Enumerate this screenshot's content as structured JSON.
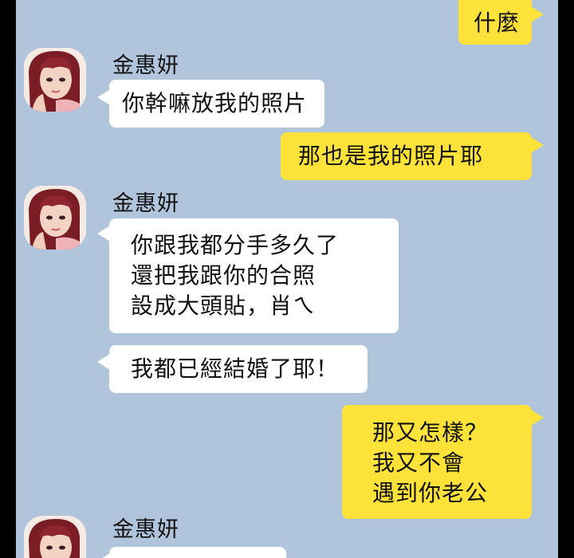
{
  "chat": {
    "contact_name": "金惠妍",
    "messages": [
      {
        "from": "me",
        "text": "什麼"
      },
      {
        "from": "contact",
        "sender": "金惠妍",
        "text": "你幹嘛放我的照片"
      },
      {
        "from": "me",
        "text": "那也是我的照片耶"
      },
      {
        "from": "contact",
        "sender": "金惠妍",
        "lines": [
          "你跟我都分手多久了",
          "還把我跟你的合照",
          "設成大頭貼，肖ㄟ"
        ]
      },
      {
        "from": "contact",
        "text": "我都已經結婚了耶！"
      },
      {
        "from": "me",
        "lines": [
          "那又怎樣？",
          "我又不會",
          "遇到你老公"
        ]
      },
      {
        "from": "contact",
        "sender": "金惠妍",
        "text": ""
      }
    ]
  },
  "colors": {
    "background": "#b0c4dc",
    "incoming_bubble": "#ffffff",
    "outgoing_bubble": "#fde23a"
  },
  "icons": {
    "avatar": "contact-avatar-icon"
  }
}
